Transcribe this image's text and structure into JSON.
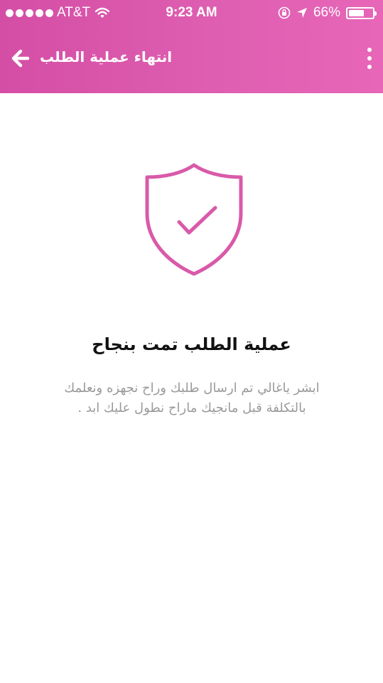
{
  "status_bar": {
    "carrier": "AT&T",
    "time": "9:23 AM",
    "battery": "66%",
    "battery_level": 0.66,
    "icons": [
      "signal-dots",
      "wifi-icon",
      "orientation-lock-icon",
      "location-arrow-icon",
      "battery-icon"
    ]
  },
  "header": {
    "title": "انتهاء عملية الطلب",
    "back_icon": "arrow-left-icon",
    "menu_icon": "more-vertical-icon"
  },
  "main": {
    "icon": "shield-check-icon",
    "title": "عملية الطلب تمت بنجاح",
    "message": "ابشر ياغالي تم ارسال طلبك وراح نجهزه ونعلمك بالتكلفة قبل مانجيك ماراح نطول عليك ابد ."
  },
  "colors": {
    "header_gradient_start": "#d44ea5",
    "header_gradient_end": "#e766b8",
    "accent": "#d95aa9",
    "title_text": "#111111",
    "body_text": "#9a9a9a",
    "background": "#ffffff"
  }
}
